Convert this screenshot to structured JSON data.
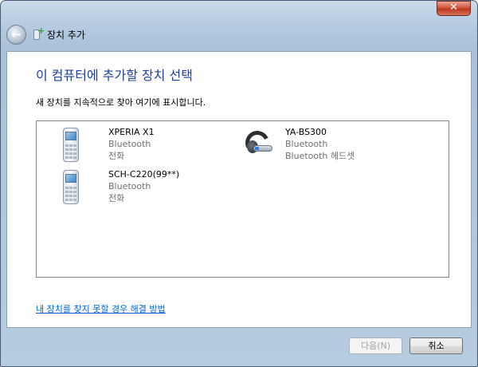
{
  "window": {
    "title": "장치 추가",
    "close_label": "✕"
  },
  "content": {
    "heading": "이 컴퓨터에 추가할 장치 선택",
    "subtitle": "새 장치를 지속적으로 찾아 여기에 표시합니다."
  },
  "devices": [
    {
      "name": "XPERIA X1",
      "type": "Bluetooth",
      "category": "전화",
      "icon": "phone-icon"
    },
    {
      "name": "YA-BS300",
      "type": "Bluetooth",
      "category": "Bluetooth 헤드셋",
      "icon": "headset-icon"
    },
    {
      "name": "SCH-C220(99**)",
      "type": "Bluetooth",
      "category": "전화",
      "icon": "phone-icon"
    }
  ],
  "help_link": "내 장치를 찾지 못할 경우 해결 방법",
  "buttons": {
    "next": "다음(N)",
    "cancel": "취소"
  }
}
